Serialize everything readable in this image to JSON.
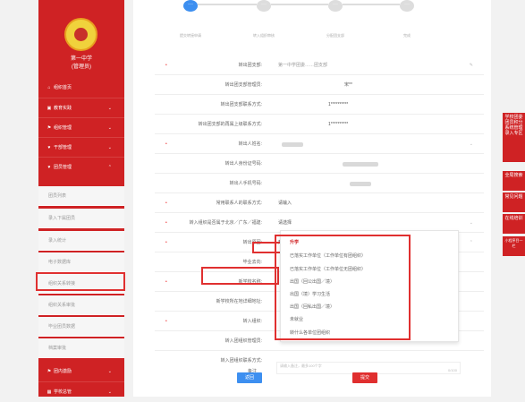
{
  "sidebar": {
    "school": "第一中学",
    "role": "(管理员)",
    "items": [
      {
        "label": "组织首页",
        "icon": "home-icon"
      },
      {
        "label": "教育实践",
        "icon": "book-icon"
      },
      {
        "label": "组织管理",
        "icon": "org-icon"
      },
      {
        "label": "干部管理",
        "icon": "people-icon"
      },
      {
        "label": "团员管理",
        "icon": "member-icon"
      }
    ],
    "sub_items": [
      "团员列表",
      "录入下属团员",
      "录入统计",
      "电子数据库",
      "组织关系转接",
      "组织关系审批",
      "毕业团员数据",
      "档案审批"
    ],
    "bottom_items": [
      {
        "label": "团内激励"
      },
      {
        "label": "学校总管"
      }
    ]
  },
  "steps": [
    "提交转接申请",
    "转入组织审核",
    "分配团支部",
    "完成"
  ],
  "form": {
    "rows": [
      {
        "label": "转出团支部:",
        "required": true,
        "value": "第一中学团委……团支部",
        "icon": "edit-icon"
      },
      {
        "label": "转出团支部管理员:",
        "required": false,
        "value": "宋**"
      },
      {
        "label": "转出团支部联系方式:",
        "required": false,
        "value": "1**********"
      },
      {
        "label": "转出团支部的再属上级联系方式:",
        "required": false,
        "value": "1**********"
      },
      {
        "label": "转出人姓名:",
        "required": true,
        "value": ""
      },
      {
        "label": "转出人身份证号码:",
        "required": false,
        "value": ""
      },
      {
        "label": "转出人手机号码:",
        "required": false,
        "value": ""
      },
      {
        "label": "常用联系人的联系方式:",
        "required": true,
        "value": "请输入"
      },
      {
        "label": "转入组织是否属于北京／广东／福建:",
        "required": true,
        "value": "请选择"
      },
      {
        "label": "转出原因:",
        "required": true,
        "value": "升学"
      },
      {
        "label": "毕业去向:",
        "required": false,
        "value": ""
      },
      {
        "label": "新学校名称:",
        "required": true,
        "value": ""
      },
      {
        "label": "新学校所在地详细地址:",
        "required": false,
        "value": ""
      },
      {
        "label": "转入组织:",
        "required": true,
        "value": ""
      },
      {
        "label": "转入团组织管理员:",
        "required": false,
        "value": ""
      },
      {
        "label": "转入团组织联系方式:",
        "required": false,
        "value": ""
      },
      {
        "label": "备注",
        "required": false,
        "value": "请输入备注，最多100个字",
        "counter": "0/100"
      }
    ]
  },
  "dropdown": {
    "options": [
      "升学",
      "已落实工作单位（工作单位有团组织）",
      "已落实工作单位（工作单位无团组织）",
      "出国（回公出国／境）",
      "出国（境）学习生活",
      "出国（回私出国／境）",
      "未就业",
      "转什么各单位团组织"
    ]
  },
  "buttons": {
    "back": "返回",
    "submit": "提交"
  },
  "rightbar": [
    "学校团委团员积分系统管理录入专区",
    "全局搜索",
    "常见问题",
    "在线培训",
    "小程序目一栏"
  ],
  "colors": {
    "brand_red": "#cf2224",
    "primary_blue": "#3d8ff0"
  }
}
